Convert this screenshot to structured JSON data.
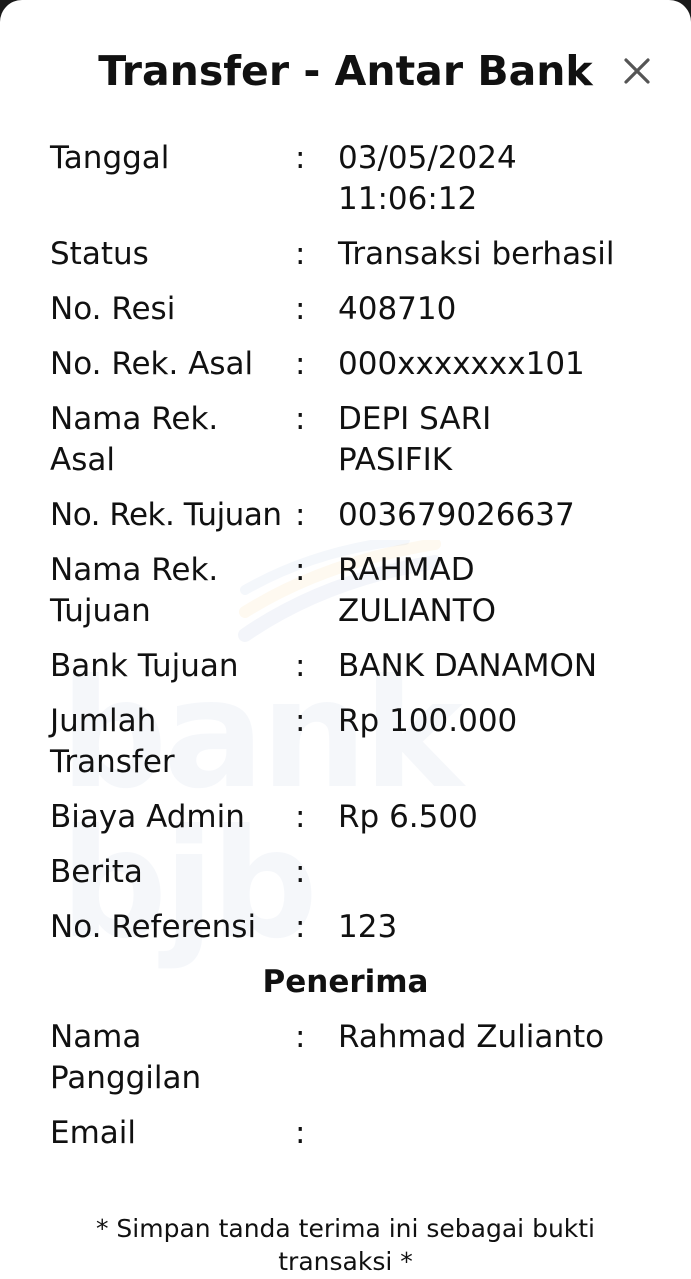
{
  "header": {
    "title": "Transfer - Antar Bank",
    "close_icon": "close-icon"
  },
  "watermark": {
    "text": "bank bjb"
  },
  "details": [
    {
      "label": "Tanggal",
      "value": "03/05/2024\n11:06:12"
    },
    {
      "label": "Status",
      "value": "Transaksi berhasil"
    },
    {
      "label": "No. Resi",
      "value": "408710"
    },
    {
      "label": "No. Rek. Asal",
      "value": "000xxxxxxx101"
    },
    {
      "label": "Nama Rek.\nAsal",
      "value": "DEPI SARI\nPASIFIK"
    },
    {
      "label": "No. Rek. Tujuan",
      "value": "003679026637"
    },
    {
      "label": "Nama Rek.\nTujuan",
      "value": "RAHMAD\nZULIANTO"
    },
    {
      "label": "Bank Tujuan",
      "value": "BANK DANAMON"
    },
    {
      "label": "Jumlah\nTransfer",
      "value": "Rp 100.000"
    },
    {
      "label": "Biaya Admin",
      "value": "Rp 6.500"
    },
    {
      "label": "Berita",
      "value": ""
    },
    {
      "label": "No. Referensi",
      "value": "123"
    }
  ],
  "recipient": {
    "section_title": "Penerima",
    "items": [
      {
        "label": "Nama\nPanggilan",
        "value": "Rahmad Zulianto"
      },
      {
        "label": "Email",
        "value": ""
      }
    ]
  },
  "separator": ":",
  "footer": {
    "note": "* Simpan tanda terima ini sebagai bukti transaksi *"
  },
  "colors": {
    "background": "#ffffff",
    "text": "#111111",
    "watermark": "#2d5aa8"
  }
}
